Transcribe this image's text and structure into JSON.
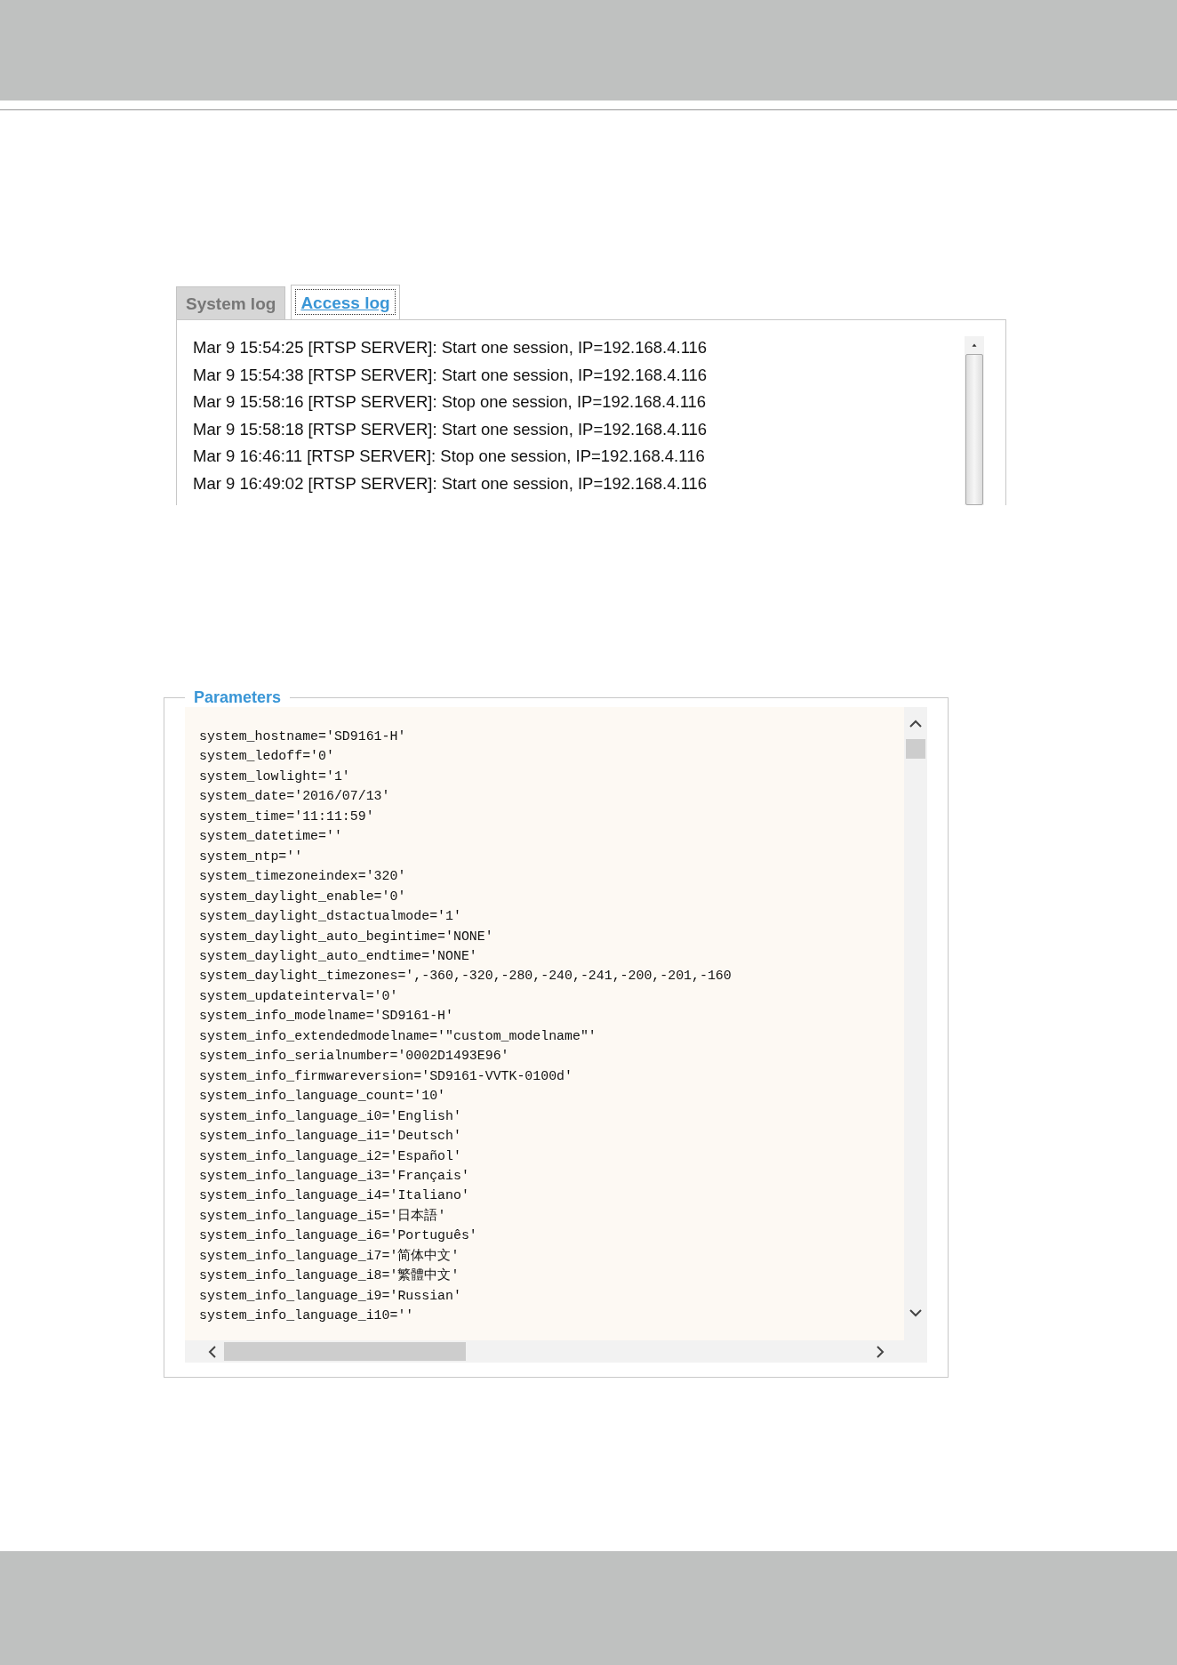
{
  "log_tabs": [
    {
      "label": "System log",
      "selected": false
    },
    {
      "label": "Access log",
      "selected": true
    }
  ],
  "log_lines": [
    "Mar 9 15:54:25 [RTSP SERVER]: Start one session, IP=192.168.4.116",
    "Mar 9 15:54:38 [RTSP SERVER]: Start one session, IP=192.168.4.116",
    "Mar 9 15:58:16 [RTSP SERVER]: Stop one session, IP=192.168.4.116",
    "Mar 9 15:58:18 [RTSP SERVER]: Start one session, IP=192.168.4.116",
    "Mar 9 16:46:11 [RTSP SERVER]: Stop one session, IP=192.168.4.116",
    "Mar 9 16:49:02 [RTSP SERVER]: Start one session, IP=192.168.4.116"
  ],
  "parameters": {
    "title": "Parameters",
    "lines": [
      "system_hostname='SD9161-H'",
      "system_ledoff='0'",
      "system_lowlight='1'",
      "system_date='2016/07/13'",
      "system_time='11:11:59'",
      "system_datetime=''",
      "system_ntp=''",
      "system_timezoneindex='320'",
      "system_daylight_enable='0'",
      "system_daylight_dstactualmode='1'",
      "system_daylight_auto_begintime='NONE'",
      "system_daylight_auto_endtime='NONE'",
      "system_daylight_timezones=',-360,-320,-280,-240,-241,-200,-201,-160",
      "system_updateinterval='0'",
      "system_info_modelname='SD9161-H'",
      "system_info_extendedmodelname='\"custom_modelname\"'",
      "system_info_serialnumber='0002D1493E96'",
      "system_info_firmwareversion='SD9161-VVTK-0100d'",
      "system_info_language_count='10'",
      "system_info_language_i0='English'",
      "system_info_language_i1='Deutsch'",
      "system_info_language_i2='Español'",
      "system_info_language_i3='Français'",
      "system_info_language_i4='Italiano'",
      "system_info_language_i5='日本語'",
      "system_info_language_i6='Português'",
      "system_info_language_i7='简体中文'",
      "system_info_language_i8='繁體中文'",
      "system_info_language_i9='Russian'",
      "system_info_language_i10=''"
    ]
  }
}
